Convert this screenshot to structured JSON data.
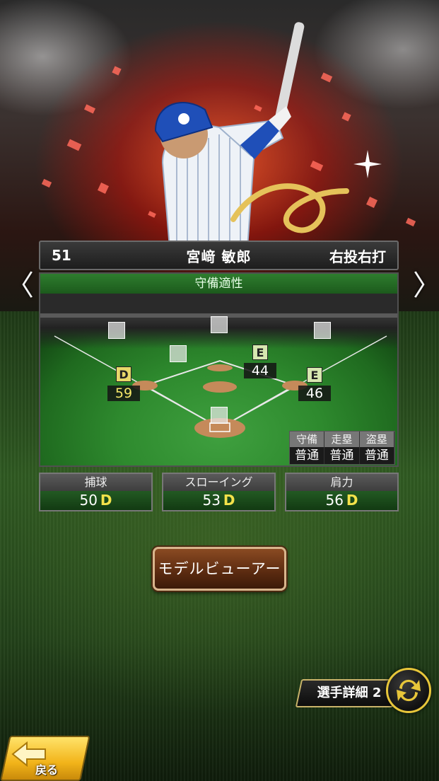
{
  "player": {
    "number": "51",
    "name": "宮﨑 敏郎",
    "handedness": "右投右打"
  },
  "nav": {
    "prev_icon": "chevron-left-icon",
    "next_icon": "chevron-right-icon",
    "prev_glyph": "〈",
    "next_glyph": "〉"
  },
  "fielding": {
    "title": "守備適性",
    "positions": {
      "first_base": {
        "rank": "E",
        "value": "46"
      },
      "second_base": {
        "rank": "E",
        "value": "44"
      },
      "third_base": {
        "rank": "D",
        "value": "59"
      }
    },
    "mini_table": {
      "headers": [
        "守備",
        "走塁",
        "盗塁"
      ],
      "values": [
        "普通",
        "普通",
        "普通"
      ]
    }
  },
  "stats": [
    {
      "label": "捕球",
      "value": "50",
      "rank": "D"
    },
    {
      "label": "スローイング",
      "value": "53",
      "rank": "D"
    },
    {
      "label": "肩力",
      "value": "56",
      "rank": "D"
    }
  ],
  "buttons": {
    "model_viewer": "モデルビューアー",
    "player_detail": "選手詳細 2",
    "back": "戻る"
  },
  "colors": {
    "rank_d": "#e8d86a",
    "rank_e": "#d7e7b0",
    "field_header": "#2e7d2e",
    "stat_rank": "#f4e24a",
    "team_blue": "#1f4fb8"
  }
}
